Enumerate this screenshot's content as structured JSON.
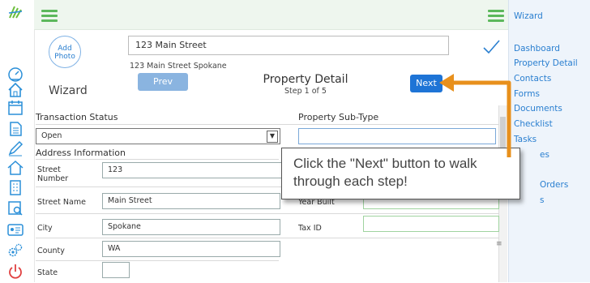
{
  "colors": {
    "accent": "#1e74d6",
    "brand_green": "#5cb85c",
    "arrow": "#e8901c"
  },
  "header": {
    "photo_line1": "Add",
    "photo_line2": "Photo",
    "address_value": "123 Main Street",
    "address_sub": "123 Main Street Spokane",
    "wizard_title": "Wizard",
    "prev_label": "Prev",
    "next_label": "Next",
    "step_title": "Property Detail",
    "step_sub": "Step 1 of 5"
  },
  "rightnav": {
    "title": "Wizard",
    "items": [
      "Dashboard",
      "Property Detail",
      "Contacts",
      "Forms",
      "Documents",
      "Checklist",
      "Tasks",
      "es",
      "Orders",
      "s"
    ]
  },
  "form": {
    "transaction_status_label": "Transaction Status",
    "transaction_status_value": "Open",
    "property_subtype_label": "Property Sub-Type",
    "address_info_label": "Address Information",
    "street_number_label": "Street Number",
    "street_number_value": "123",
    "street_name_label": "Street Name",
    "street_name_value": "Main Street",
    "city_label": "City",
    "city_value": "Spokane",
    "county_label": "County",
    "county_value": "WA",
    "state_label": "State",
    "year_built_label": "Year Built",
    "tax_id_label": "Tax ID"
  },
  "tooltip": {
    "text": "Click the \"Next\" button to walk through each step!"
  },
  "icons": [
    "logo-icon",
    "hamburger-icon",
    "gauge-icon",
    "home-icon",
    "calendar-icon",
    "document-icon",
    "pen-icon",
    "house-outline-icon",
    "building-icon",
    "search-document-icon",
    "contact-card-icon",
    "gears-icon",
    "power-icon",
    "checkmark-icon",
    "dropdown-arrow-icon"
  ]
}
